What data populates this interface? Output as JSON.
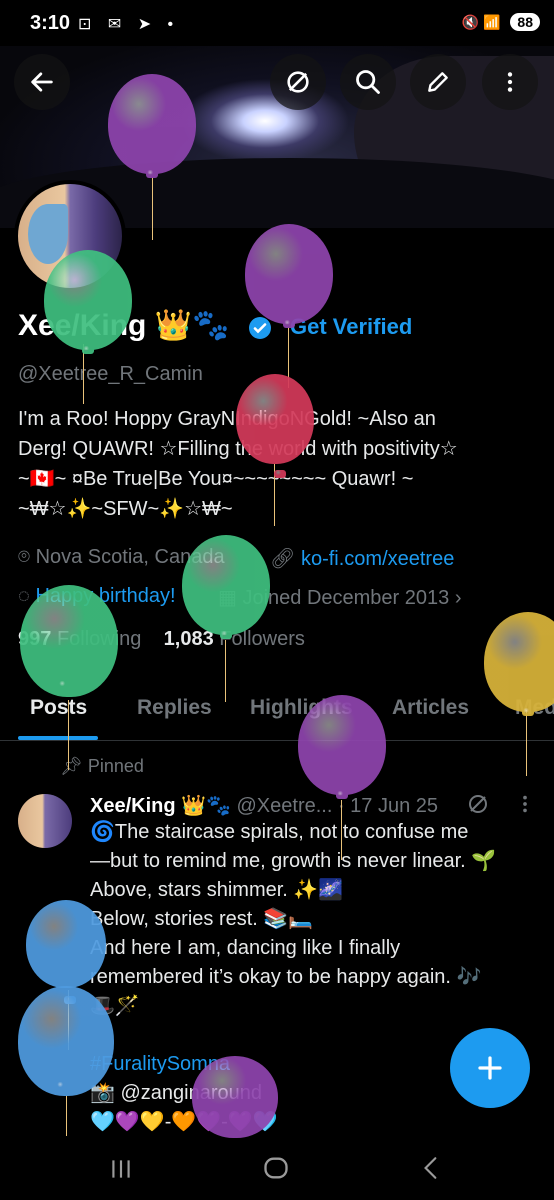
{
  "status_bar": {
    "time": "3:10",
    "icons": "⊡ ✉ ➤ •",
    "signal": "🔇 📶",
    "battery": "88"
  },
  "banner": {
    "image": "dark fantasy landscape with glowing moon"
  },
  "profile": {
    "name": "Xee/King 👑🐾",
    "verified_label": "Get Verified",
    "handle": "@Xeetree_R_Camin",
    "bio": [
      "I'm a Roo! Hoppy GrayNIndigoNGold!  ~Also an",
      "Derg! QUAWR!  ☆Filling the world with positivity☆",
      "~🇨🇦~  ¤Be True|Be You¤~~~~~~~~  Quawr! ~",
      "~₩☆✨~SFW~✨☆₩~"
    ],
    "location": "Nova Scotia, Canada",
    "website": "ko-fi.com/xeetree",
    "birthday": "Happy birthday!",
    "joined": "Joined December 2013",
    "following_count": "997",
    "following_label": "Following",
    "followers_count": "1,083",
    "followers_label": "Followers"
  },
  "tabs": [
    "Posts",
    "Replies",
    "Highlights",
    "Articles",
    "Media"
  ],
  "post": {
    "pinned_label": "Pinned",
    "author": "Xee/King 👑🐾",
    "handle": "@Xeetre...",
    "date": "· 17 Jun 25",
    "lines": [
      "🌀The staircase spirals, not to confuse me",
      "—but to remind me, growth is never linear. 🌱",
      "Above, stars shimmer. ✨🌌",
      "Below, stories rest. 📚🛏️",
      "And here I am, dancing like I finally",
      "remembered it’s okay to be happy again. 🎶",
      "🎩🪄"
    ],
    "hashtag": "#FuralitySomna",
    "mention": "📸 @zanginaround",
    "hearts": "🩵💜💛-🧡💜-💜🩵"
  },
  "colors": {
    "accent": "#1d9bf0",
    "background": "#000000",
    "muted": "#71767b"
  },
  "balloons": [
    {
      "color": "#8e44ad"
    },
    {
      "color": "#3fbf7f"
    },
    {
      "color": "#8e44ad"
    },
    {
      "color": "#d33a5a"
    },
    {
      "color": "#3fbf7f"
    },
    {
      "color": "#3fbf7f"
    },
    {
      "color": "#d9b43a"
    },
    {
      "color": "#8e44ad"
    },
    {
      "color": "#4f9be0"
    },
    {
      "color": "#4f9be0"
    },
    {
      "color": "#8e44ad"
    }
  ]
}
